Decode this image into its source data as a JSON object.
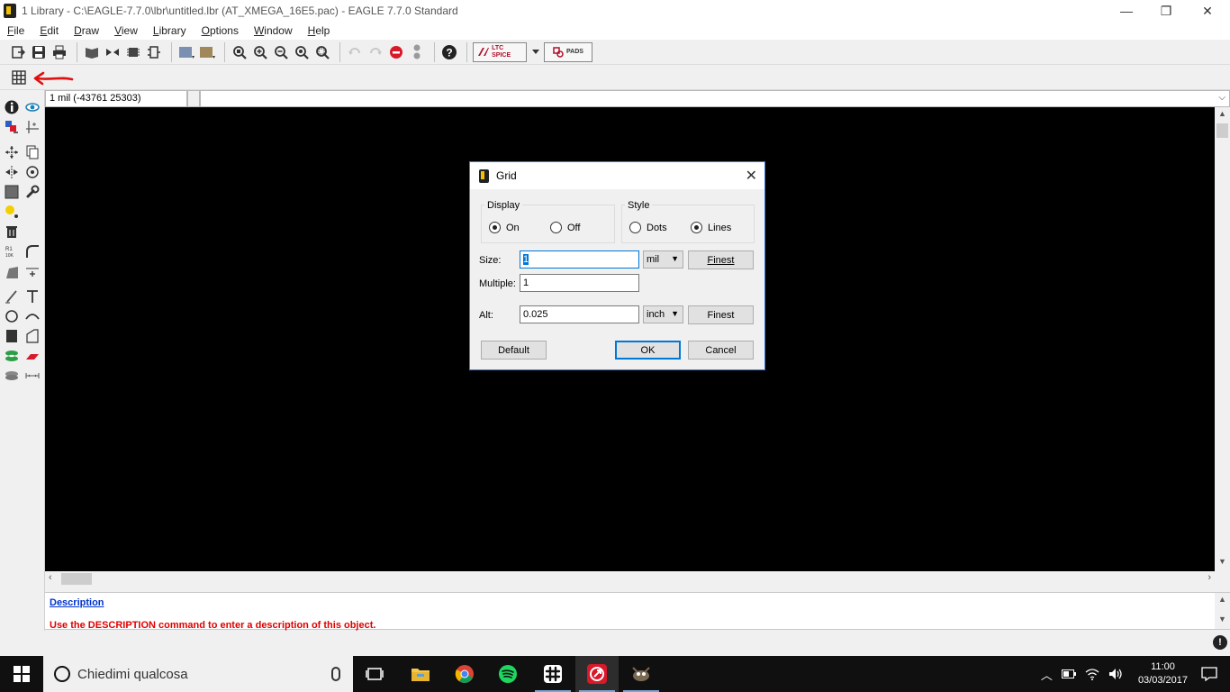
{
  "window": {
    "title": "1 Library - C:\\EAGLE-7.7.0\\lbr\\untitled.lbr (AT_XMEGA_16E5.pac) - EAGLE 7.7.0 Standard",
    "minimize": "—",
    "restore": "❐",
    "close": "✕"
  },
  "menu": [
    {
      "accel": "F",
      "rest": "ile"
    },
    {
      "accel": "E",
      "rest": "dit"
    },
    {
      "accel": "D",
      "rest": "raw"
    },
    {
      "accel": "V",
      "rest": "iew"
    },
    {
      "accel": "L",
      "rest": "ibrary"
    },
    {
      "accel": "O",
      "rest": "ptions"
    },
    {
      "accel": "W",
      "rest": "indow"
    },
    {
      "accel": "H",
      "rest": "elp"
    }
  ],
  "toolbar": {
    "ltspice_label": "LTC SPICE",
    "pads_label": "PADS"
  },
  "coordbar": {
    "readout": "1 mil (-43761 25303)",
    "dropdown_glyph": "⌵"
  },
  "description": {
    "link": "Description",
    "hint": "Use the DESCRIPTION command to enter a description of this object."
  },
  "status": {
    "stop_glyph": "!"
  },
  "dialog": {
    "title": "Grid",
    "display": {
      "label": "Display",
      "on": "On",
      "off": "Off",
      "selected": "on"
    },
    "style": {
      "label": "Style",
      "dots": "Dots",
      "lines": "Lines",
      "selected": "lines"
    },
    "size": {
      "label": "Size:",
      "value": "1",
      "unit": "mil",
      "finest": "Finest"
    },
    "multiple": {
      "label": "Multiple:",
      "value": "1"
    },
    "alt": {
      "label": "Alt:",
      "value": "0.025",
      "unit": "inch",
      "finest": "Finest"
    },
    "buttons": {
      "default": "Default",
      "ok": "OK",
      "cancel": "Cancel"
    }
  },
  "taskbar": {
    "search_placeholder": "Chiedimi qualcosa",
    "time": "11:00",
    "date": "03/03/2017"
  },
  "colors": {
    "canvas": "#000000",
    "accent": "#0078d7",
    "hint_red": "#e00000",
    "link_blue": "#0033cc"
  }
}
